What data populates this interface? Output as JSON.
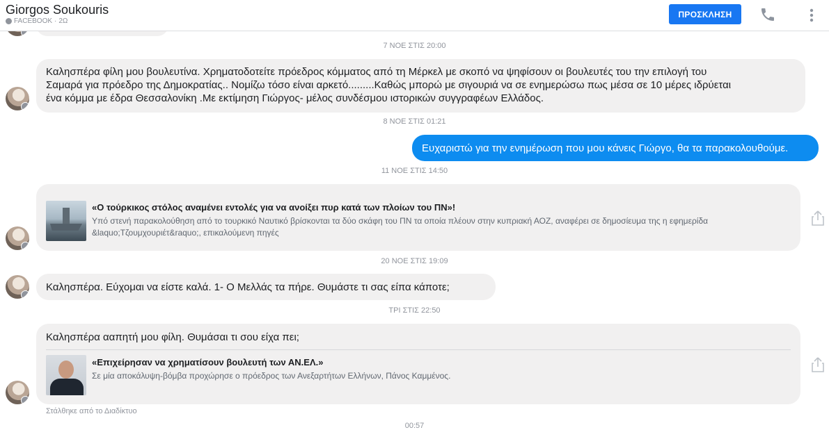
{
  "header": {
    "contact_name": "Giorgos Soukouris",
    "source": "FACEBOOK",
    "separator": "·",
    "last_active": "2Ω",
    "invite_label": "ΠΡΟΣΚΛΗΣΗ",
    "icons": [
      "facebook-icon",
      "phone-icon",
      "more-vertical-icon"
    ]
  },
  "conversation": {
    "timestamps": [
      "7 ΝΟΕ ΣΤΙΣ 20:00",
      "8 ΝΟΕ ΣΤΙΣ 01:21",
      "11 ΝΟΕ ΣΤΙΣ 14:50",
      "20 ΝΟΕ ΣΤΙΣ 19:09",
      "ΤΡΙ ΣΤΙΣ 22:50",
      "00:57"
    ],
    "messages": [
      {
        "sender": "incoming",
        "lines": [
          "Καλησπέρα φίλη μου βουλευτίνα. Χρηματοδοτείτε πρόεδρος κόμματος από τη Μέρκελ με σκοπό να ψηφίσουν οι βουλευτές του την επιλογή του",
          "Σαμαρά για πρόεδρο της Δημοκρατίας.. Νομίζω τόσο είναι αρκετό.........Καθώς μπορώ με σιγουριά να σε ενημερώσω πως μέσα σε 10 μέρες ιδρύεται",
          "ένα κόμμα με έδρα Θεσσαλονίκη  .Με εκτίμηση Γιώργος- μέλος συνδέσμου  ιστορικών συγγραφέων Ελλάδος."
        ]
      },
      {
        "sender": "outgoing",
        "text": "Ευχαριστώ για την ενημέρωση που μου κάνεις Γιώργο, θα τα παρακολουθούμε."
      },
      {
        "sender": "incoming",
        "link": {
          "title": "«Ο τούρκικος στόλος αναμένει εντολές για να ανοίξει πυρ κατά των πλοίων του ΠΝ»!",
          "description_lines": [
            "Υπό στενή παρακολούθηση από το τουρκικό Ναυτικό βρίσκονται τα δύο σκάφη του ΠΝ τα οποία πλέουν στην κυπριακή ΑΟΖ, αναφέρει σε δημοσίευμα της η εφημερίδα",
            "&laquo;Τζουμχουριέτ&raquo;, επικαλούμενη πηγές"
          ],
          "thumbnail": "warship-image"
        }
      },
      {
        "sender": "incoming",
        "text": "Καλησπέρα. Εύχομαι να είστε καλά. 1- Ο Μελλάς τα πήρε. Θυμάστε τι σας είπα κάποτε;"
      },
      {
        "sender": "incoming",
        "text": "Καλησπέρα ααπητή μου φίλη. Θυμάσαι τι σου είχα πει;",
        "link": {
          "title": "«Επιχείρησαν να χρηματίσουν βουλευτή των ΑΝ.ΕΛ.»",
          "description": "Σε μία αποκάλυψη-βόμβα προχώρησε ο πρόεδρος των Ανεξαρτήτων Ελλήνων, Πάνος Καμμένος.",
          "thumbnail": "politician-photo"
        },
        "footnote": "Στάλθηκε από το Διαδίκτυο"
      }
    ]
  }
}
